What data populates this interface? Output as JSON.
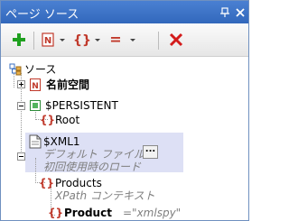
{
  "panel": {
    "title": "ページ ソース"
  },
  "toolbar": {
    "add": "+",
    "elem_letter": "N",
    "xpath_glyph": "{}",
    "assign_glyph": "=",
    "delete_glyph": "✕"
  },
  "tree": {
    "root_label": "ソース",
    "namespace_label": "名前空間",
    "persistent_label": "$PERSISTENT",
    "persistent_root": "Root",
    "xml_label": "$XML1",
    "default_file_label": "デフォルト ファイル:",
    "ellipsis": "...",
    "load_label": "初回使用時のロード",
    "products_label": "Products",
    "xpath_context_label": "XPath コンテキスト",
    "product_label": "Product",
    "product_value": "=\"xmlspy\""
  }
}
